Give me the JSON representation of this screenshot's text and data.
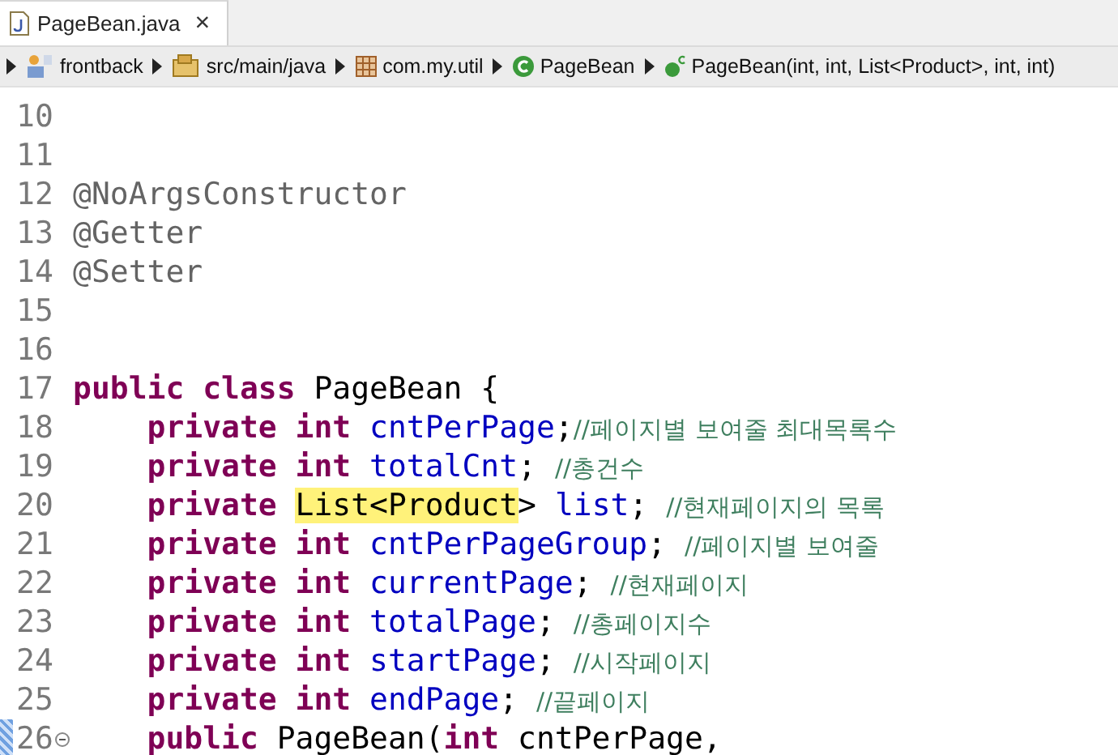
{
  "tab": {
    "title": "PageBean.java",
    "close": "×",
    "selected": true
  },
  "breadcrumb": [
    {
      "kind": "project",
      "label": "frontback"
    },
    {
      "kind": "source",
      "label": "src/main/java"
    },
    {
      "kind": "package",
      "label": "com.my.util"
    },
    {
      "kind": "class",
      "label": "PageBean"
    },
    {
      "kind": "constructor",
      "label": "PageBean(int, int, List<Product>, int, int)"
    }
  ],
  "lines": [
    {
      "number": "10"
    },
    {
      "number": "11"
    },
    {
      "number": "12",
      "tokens": [
        {
          "kind": "annotation",
          "text": "@NoArgsConstructor"
        }
      ]
    },
    {
      "number": "13",
      "tokens": [
        {
          "kind": "annotation",
          "text": "@Getter"
        }
      ]
    },
    {
      "number": "14",
      "tokens": [
        {
          "kind": "annotation",
          "text": "@Setter"
        }
      ]
    },
    {
      "number": "15"
    },
    {
      "number": "16"
    },
    {
      "number": "17",
      "tokens": [
        {
          "kind": "keyword",
          "text": "public class "
        },
        {
          "kind": "plain",
          "text": "PageBean {"
        }
      ]
    },
    {
      "number": "18",
      "indented": true,
      "tokens": [
        {
          "kind": "keyword",
          "text": "private int "
        },
        {
          "kind": "field",
          "text": "cntPerPage"
        },
        {
          "kind": "plain",
          "text": ";"
        },
        {
          "kind": "comment",
          "text": "//페이지별 보여줄 최대목록수"
        }
      ]
    },
    {
      "number": "19",
      "indented": true,
      "tokens": [
        {
          "kind": "keyword",
          "text": "private int "
        },
        {
          "kind": "field",
          "text": "totalCnt"
        },
        {
          "kind": "plain",
          "text": "; "
        },
        {
          "kind": "comment",
          "text": "//총건수"
        }
      ]
    },
    {
      "number": "20",
      "indented": true,
      "tokens": [
        {
          "kind": "keyword",
          "text": "private "
        },
        {
          "kind": "highlight",
          "text": "List<Product"
        },
        {
          "kind": "plain",
          "text": "> "
        },
        {
          "kind": "field",
          "text": "list"
        },
        {
          "kind": "plain",
          "text": "; "
        },
        {
          "kind": "comment",
          "text": "//현재페이지의 목록"
        }
      ]
    },
    {
      "number": "21",
      "indented": true,
      "tokens": [
        {
          "kind": "keyword",
          "text": "private int "
        },
        {
          "kind": "field",
          "text": "cntPerPageGroup"
        },
        {
          "kind": "plain",
          "text": "; "
        },
        {
          "kind": "comment",
          "text": "//페이지별 보여줄"
        }
      ]
    },
    {
      "number": "22",
      "indented": true,
      "tokens": [
        {
          "kind": "keyword",
          "text": "private int "
        },
        {
          "kind": "field",
          "text": "currentPage"
        },
        {
          "kind": "plain",
          "text": "; "
        },
        {
          "kind": "comment",
          "text": "//현재페이지"
        }
      ]
    },
    {
      "number": "23",
      "indented": true,
      "tokens": [
        {
          "kind": "keyword",
          "text": "private int "
        },
        {
          "kind": "field",
          "text": "totalPage"
        },
        {
          "kind": "plain",
          "text": "; "
        },
        {
          "kind": "comment",
          "text": "//총페이지수"
        }
      ]
    },
    {
      "number": "24",
      "indented": true,
      "tokens": [
        {
          "kind": "keyword",
          "text": "private int "
        },
        {
          "kind": "field",
          "text": "startPage"
        },
        {
          "kind": "plain",
          "text": "; "
        },
        {
          "kind": "comment",
          "text": "//시작페이지"
        }
      ]
    },
    {
      "number": "25",
      "indented": true,
      "tokens": [
        {
          "kind": "keyword",
          "text": "private int "
        },
        {
          "kind": "field",
          "text": "endPage"
        },
        {
          "kind": "plain",
          "text": "; "
        },
        {
          "kind": "comment",
          "text": "//끝페이지"
        }
      ]
    },
    {
      "number": "26",
      "changed": true,
      "foldable": true,
      "indented": true,
      "tokens": [
        {
          "kind": "keyword",
          "text": "public "
        },
        {
          "kind": "plain",
          "text": "PageBean("
        },
        {
          "kind": "keyword",
          "text": "int "
        },
        {
          "kind": "plain",
          "text": "cntPerPage,"
        }
      ]
    }
  ]
}
